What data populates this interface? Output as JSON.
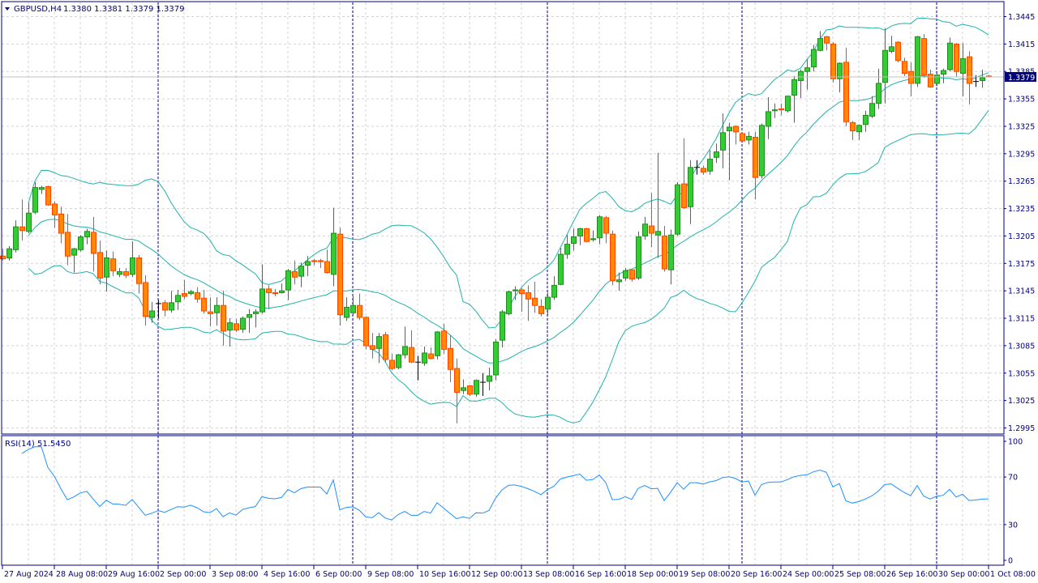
{
  "header": {
    "symbol": "GBPUSD,H4",
    "ohlc": "1.3380 1.3381 1.3379 1.3379"
  },
  "rsi": {
    "label": "RSI(14) 51.5450",
    "period": 14,
    "levels": [
      "100",
      "70",
      "30",
      "0"
    ]
  },
  "price_axis": {
    "labels": [
      "1.3445",
      "1.3415",
      "1.3385",
      "1.3355",
      "1.3325",
      "1.3295",
      "1.3265",
      "1.3235",
      "1.3205",
      "1.3175",
      "1.3145",
      "1.3115",
      "1.3085",
      "1.3055",
      "1.3025",
      "1.2995"
    ],
    "current_price": "1.3379"
  },
  "time_axis": {
    "labels": [
      "27 Aug 2024",
      "28 Aug 08:00",
      "29 Aug 16:00",
      "2 Sep 00:00",
      "3 Sep 08:00",
      "4 Sep 16:00",
      "6 Sep 00:00",
      "9 Sep 08:00",
      "10 Sep 16:00",
      "12 Sep 00:00",
      "13 Sep 08:00",
      "16 Sep 16:00",
      "18 Sep 00:00",
      "19 Sep 08:00",
      "20 Sep 16:00",
      "24 Sep 00:00",
      "25 Sep 08:00",
      "26 Sep 16:00",
      "30 Sep 00:00",
      "1 Oct 08:00"
    ]
  },
  "colors": {
    "bull": "#32CD32",
    "bull_edge": "#228B22",
    "bear": "#FF8C00",
    "bear_edge": "#FF4500",
    "doji": "#000000",
    "bands": "#20B2AA",
    "rsi_line": "#1E90FF",
    "frame": "#000080",
    "grid": "#D3D3D3"
  },
  "indicators": {
    "bollinger_period": 20,
    "bollinger_deviation": 2
  },
  "chart_data": {
    "type": "candlestick",
    "timeframe": "H4",
    "ylim": [
      1.2995,
      1.3445
    ],
    "week_separators_at_candle": [
      24,
      54,
      84,
      114,
      144
    ],
    "candles_ohlc": [
      [
        1.3183,
        1.3191,
        1.3178,
        1.318
      ],
      [
        1.3181,
        1.3194,
        1.3178,
        1.3191
      ],
      [
        1.319,
        1.3222,
        1.3187,
        1.3215
      ],
      [
        1.3215,
        1.3245,
        1.32,
        1.3211
      ],
      [
        1.321,
        1.3241,
        1.3208,
        1.323
      ],
      [
        1.3231,
        1.3264,
        1.3229,
        1.3258
      ],
      [
        1.3256,
        1.326,
        1.3251,
        1.3258
      ],
      [
        1.3259,
        1.326,
        1.3238,
        1.3239
      ],
      [
        1.324,
        1.3243,
        1.3214,
        1.3228
      ],
      [
        1.3229,
        1.3237,
        1.3197,
        1.3208
      ],
      [
        1.3209,
        1.3229,
        1.3173,
        1.3183
      ],
      [
        1.3184,
        1.3192,
        1.3165,
        1.3191
      ],
      [
        1.319,
        1.3206,
        1.3188,
        1.3204
      ],
      [
        1.3204,
        1.3213,
        1.3196,
        1.321
      ],
      [
        1.3209,
        1.3226,
        1.3166,
        1.3186
      ],
      [
        1.3187,
        1.32,
        1.3152,
        1.3159
      ],
      [
        1.316,
        1.3189,
        1.3144,
        1.3181
      ],
      [
        1.318,
        1.3188,
        1.3161,
        1.3167
      ],
      [
        1.3163,
        1.317,
        1.316,
        1.3166
      ],
      [
        1.3166,
        1.317,
        1.3159,
        1.3162
      ],
      [
        1.3163,
        1.3199,
        1.316,
        1.3181
      ],
      [
        1.3181,
        1.3184,
        1.3142,
        1.3153
      ],
      [
        1.3154,
        1.3162,
        1.3107,
        1.3117
      ],
      [
        1.3116,
        1.3133,
        1.311,
        1.3123
      ],
      [
        1.3131,
        1.3135,
        1.3115,
        1.3131
      ],
      [
        1.3132,
        1.3135,
        1.3117,
        1.3124
      ],
      [
        1.3124,
        1.3145,
        1.3121,
        1.3132
      ],
      [
        1.3133,
        1.3146,
        1.3124,
        1.314
      ],
      [
        1.3142,
        1.3157,
        1.3136,
        1.3139
      ],
      [
        1.3142,
        1.3146,
        1.314,
        1.3144
      ],
      [
        1.3143,
        1.3149,
        1.3132,
        1.3136
      ],
      [
        1.3137,
        1.3146,
        1.312,
        1.3123
      ],
      [
        1.3122,
        1.3138,
        1.3106,
        1.312
      ],
      [
        1.3121,
        1.3138,
        1.3107,
        1.3129
      ],
      [
        1.3129,
        1.3145,
        1.3085,
        1.3101
      ],
      [
        1.3102,
        1.3115,
        1.3084,
        1.311
      ],
      [
        1.3109,
        1.3114,
        1.31,
        1.3102
      ],
      [
        1.3103,
        1.3117,
        1.3099,
        1.3115
      ],
      [
        1.3116,
        1.3125,
        1.3099,
        1.3119
      ],
      [
        1.312,
        1.3125,
        1.3105,
        1.3122
      ],
      [
        1.3122,
        1.3174,
        1.312,
        1.3147
      ],
      [
        1.3147,
        1.3151,
        1.3125,
        1.3143
      ],
      [
        1.3143,
        1.3147,
        1.3139,
        1.3142
      ],
      [
        1.3143,
        1.3153,
        1.3142,
        1.3145
      ],
      [
        1.3146,
        1.3169,
        1.3135,
        1.3167
      ],
      [
        1.3166,
        1.3178,
        1.3152,
        1.316
      ],
      [
        1.3161,
        1.3176,
        1.3149,
        1.3172
      ],
      [
        1.3173,
        1.3183,
        1.3161,
        1.3177
      ],
      [
        1.3178,
        1.318,
        1.3173,
        1.3177
      ],
      [
        1.3178,
        1.318,
        1.317,
        1.3177
      ],
      [
        1.3177,
        1.319,
        1.3164,
        1.3165
      ],
      [
        1.3163,
        1.3236,
        1.315,
        1.3208
      ],
      [
        1.3207,
        1.3214,
        1.3107,
        1.3119
      ],
      [
        1.3116,
        1.3138,
        1.3112,
        1.3127
      ],
      [
        1.3121,
        1.3139,
        1.3118,
        1.3129
      ],
      [
        1.3129,
        1.3142,
        1.3113,
        1.3116
      ],
      [
        1.3116,
        1.3117,
        1.3081,
        1.3085
      ],
      [
        1.3085,
        1.3099,
        1.3071,
        1.3081
      ],
      [
        1.3082,
        1.3099,
        1.3066,
        1.3095
      ],
      [
        1.3097,
        1.31,
        1.3067,
        1.307
      ],
      [
        1.3069,
        1.3076,
        1.3058,
        1.306
      ],
      [
        1.3061,
        1.3076,
        1.3059,
        1.3075
      ],
      [
        1.3075,
        1.3106,
        1.3071,
        1.3084
      ],
      [
        1.3083,
        1.3102,
        1.3066,
        1.3067
      ],
      [
        1.3067,
        1.3074,
        1.3047,
        1.3067
      ],
      [
        1.3066,
        1.3084,
        1.3063,
        1.3077
      ],
      [
        1.3076,
        1.3083,
        1.307,
        1.3071
      ],
      [
        1.3074,
        1.3101,
        1.307,
        1.31
      ],
      [
        1.3101,
        1.3109,
        1.3076,
        1.3081
      ],
      [
        1.3082,
        1.3096,
        1.3045,
        1.3059
      ],
      [
        1.306,
        1.3071,
        1.3,
        1.3034
      ],
      [
        1.3036,
        1.3048,
        1.3032,
        1.3039
      ],
      [
        1.3041,
        1.3042,
        1.303,
        1.3032
      ],
      [
        1.3032,
        1.3048,
        1.3029,
        1.3047
      ],
      [
        1.3045,
        1.3055,
        1.303,
        1.3045
      ],
      [
        1.3046,
        1.3061,
        1.3036,
        1.3052
      ],
      [
        1.3053,
        1.3092,
        1.3047,
        1.3089
      ],
      [
        1.3091,
        1.3124,
        1.3083,
        1.3122
      ],
      [
        1.312,
        1.3145,
        1.3118,
        1.3144
      ],
      [
        1.3145,
        1.315,
        1.3135,
        1.3146
      ],
      [
        1.3146,
        1.3148,
        1.3122,
        1.3142
      ],
      [
        1.3143,
        1.3151,
        1.3112,
        1.3136
      ],
      [
        1.3137,
        1.3155,
        1.3121,
        1.3129
      ],
      [
        1.3128,
        1.3136,
        1.3117,
        1.312
      ],
      [
        1.3125,
        1.3143,
        1.3118,
        1.3138
      ],
      [
        1.3138,
        1.3161,
        1.3135,
        1.3151
      ],
      [
        1.3152,
        1.3192,
        1.3151,
        1.3185
      ],
      [
        1.3185,
        1.3206,
        1.318,
        1.3196
      ],
      [
        1.3197,
        1.3213,
        1.3189,
        1.3204
      ],
      [
        1.3205,
        1.3214,
        1.3195,
        1.3213
      ],
      [
        1.3213,
        1.3214,
        1.3198,
        1.3199
      ],
      [
        1.3201,
        1.3211,
        1.3199,
        1.3202
      ],
      [
        1.3203,
        1.3228,
        1.3196,
        1.3226
      ],
      [
        1.3225,
        1.3227,
        1.3197,
        1.3208
      ],
      [
        1.3207,
        1.3211,
        1.3151,
        1.3156
      ],
      [
        1.3155,
        1.3165,
        1.3145,
        1.3157
      ],
      [
        1.3159,
        1.317,
        1.3156,
        1.3167
      ],
      [
        1.3168,
        1.3168,
        1.3155,
        1.3158
      ],
      [
        1.3159,
        1.321,
        1.3157,
        1.3204
      ],
      [
        1.3205,
        1.3226,
        1.3201,
        1.3218
      ],
      [
        1.3216,
        1.3252,
        1.3193,
        1.3208
      ],
      [
        1.3206,
        1.3296,
        1.3181,
        1.321
      ],
      [
        1.3205,
        1.3216,
        1.3166,
        1.3169
      ],
      [
        1.3168,
        1.3212,
        1.3152,
        1.3206
      ],
      [
        1.3207,
        1.3264,
        1.3205,
        1.3261
      ],
      [
        1.3262,
        1.3312,
        1.3235,
        1.3236
      ],
      [
        1.3237,
        1.3288,
        1.3218,
        1.328
      ],
      [
        1.328,
        1.3288,
        1.3272,
        1.328
      ],
      [
        1.3279,
        1.3282,
        1.3272,
        1.3275
      ],
      [
        1.3276,
        1.3299,
        1.3272,
        1.3289
      ],
      [
        1.3291,
        1.3306,
        1.3285,
        1.3297
      ],
      [
        1.3299,
        1.3339,
        1.3279,
        1.3318
      ],
      [
        1.332,
        1.3329,
        1.3266,
        1.3324
      ],
      [
        1.3325,
        1.3326,
        1.3305,
        1.3319
      ],
      [
        1.3317,
        1.3318,
        1.3307,
        1.3309
      ],
      [
        1.331,
        1.3319,
        1.3305,
        1.3314
      ],
      [
        1.3313,
        1.3319,
        1.3245,
        1.3269
      ],
      [
        1.3271,
        1.3328,
        1.3268,
        1.3326
      ],
      [
        1.3325,
        1.3357,
        1.3311,
        1.3341
      ],
      [
        1.3342,
        1.335,
        1.3334,
        1.3343
      ],
      [
        1.3344,
        1.335,
        1.3337,
        1.3343
      ],
      [
        1.3342,
        1.3358,
        1.334,
        1.3358
      ],
      [
        1.3359,
        1.338,
        1.3329,
        1.3376
      ],
      [
        1.3375,
        1.3387,
        1.3356,
        1.3385
      ],
      [
        1.3385,
        1.3398,
        1.3365,
        1.3389
      ],
      [
        1.339,
        1.3414,
        1.3385,
        1.3409
      ],
      [
        1.3408,
        1.3429,
        1.3407,
        1.3421
      ],
      [
        1.3423,
        1.3424,
        1.3408,
        1.3416
      ],
      [
        1.3415,
        1.3417,
        1.3373,
        1.3377
      ],
      [
        1.3377,
        1.3395,
        1.3362,
        1.3394
      ],
      [
        1.3395,
        1.3411,
        1.3325,
        1.333
      ],
      [
        1.3329,
        1.3331,
        1.331,
        1.332
      ],
      [
        1.3319,
        1.3327,
        1.331,
        1.3326
      ],
      [
        1.3327,
        1.3342,
        1.3319,
        1.3337
      ],
      [
        1.3336,
        1.3358,
        1.3334,
        1.335
      ],
      [
        1.335,
        1.3388,
        1.3344,
        1.3372
      ],
      [
        1.3373,
        1.3432,
        1.335,
        1.3408
      ],
      [
        1.3407,
        1.3424,
        1.3405,
        1.3412
      ],
      [
        1.3417,
        1.3418,
        1.3395,
        1.3397
      ],
      [
        1.3396,
        1.34,
        1.338,
        1.3383
      ],
      [
        1.3385,
        1.3395,
        1.3358,
        1.3372
      ],
      [
        1.3372,
        1.3424,
        1.3368,
        1.3423
      ],
      [
        1.3421,
        1.3426,
        1.3378,
        1.3381
      ],
      [
        1.3382,
        1.3387,
        1.3367,
        1.3368
      ],
      [
        1.3372,
        1.3383,
        1.3369,
        1.3381
      ],
      [
        1.3382,
        1.3388,
        1.3372,
        1.3386
      ],
      [
        1.3387,
        1.3422,
        1.3385,
        1.3416
      ],
      [
        1.3415,
        1.3416,
        1.3379,
        1.3385
      ],
      [
        1.3383,
        1.3416,
        1.3358,
        1.3399
      ],
      [
        1.3401,
        1.3407,
        1.3349,
        1.3372
      ],
      [
        1.3374,
        1.3381,
        1.3368,
        1.3374
      ],
      [
        1.3375,
        1.3387,
        1.3367,
        1.3378
      ],
      [
        1.338,
        1.3381,
        1.3379,
        1.3379
      ]
    ]
  }
}
